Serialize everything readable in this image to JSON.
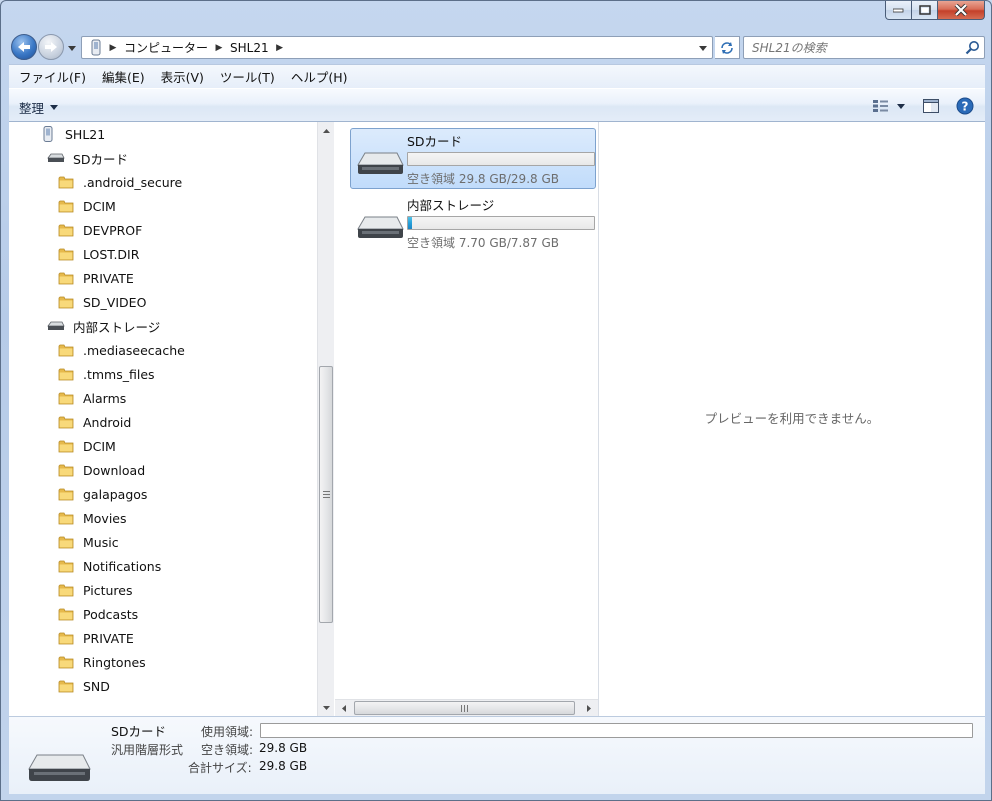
{
  "window": {
    "controls": {
      "minimize": "minimize",
      "maximize": "maximize",
      "close": "close"
    }
  },
  "address": {
    "crumbs": [
      "コンピューター",
      "SHL21"
    ]
  },
  "search": {
    "placeholder": "SHL21の検索"
  },
  "menu": [
    "ファイル(F)",
    "編集(E)",
    "表示(V)",
    "ツール(T)",
    "ヘルプ(H)"
  ],
  "toolbar": {
    "organize_label": "整理"
  },
  "tree": {
    "root": "SHL21",
    "sd_card": {
      "label": "SDカード",
      "folders": [
        ".android_secure",
        "DCIM",
        "DEVPROF",
        "LOST.DIR",
        "PRIVATE",
        "SD_VIDEO"
      ]
    },
    "internal": {
      "label": "内部ストレージ",
      "folders": [
        ".mediaseecache",
        ".tmms_files",
        "Alarms",
        "Android",
        "DCIM",
        "Download",
        "galapagos",
        "Movies",
        "Music",
        "Notifications",
        "Pictures",
        "Podcasts",
        "PRIVATE",
        "Ringtones",
        "SND"
      ]
    }
  },
  "drives": [
    {
      "name": "SDカード",
      "free_text": "空き領域 29.8 GB/29.8 GB",
      "used_fraction": 0.0,
      "selected": true
    },
    {
      "name": "内部ストレージ",
      "free_text": "空き領域 7.70 GB/7.87 GB",
      "used_fraction": 0.022,
      "selected": false
    }
  ],
  "preview": {
    "message": "プレビューを利用できません。"
  },
  "details": {
    "name": "SDカード",
    "type": "汎用階層形式",
    "used_label": "使用領域:",
    "free_label": "空き領域:",
    "free_value": "29.8 GB",
    "total_label": "合計サイズ:",
    "total_value": "29.8 GB",
    "used_fraction": 0.0
  },
  "colors": {
    "accent": "#26a0da",
    "selection": "#c1dcfb",
    "frame": "#b6cbe8"
  }
}
